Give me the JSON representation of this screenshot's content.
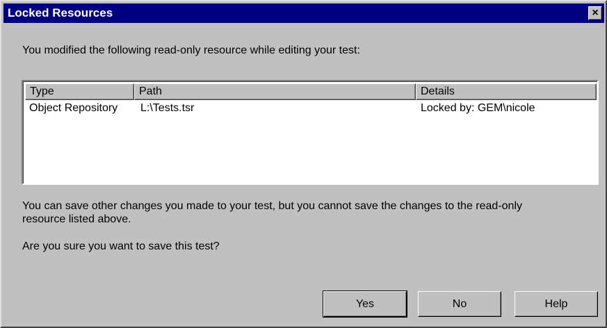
{
  "window": {
    "title": "Locked Resources",
    "close_label": "×"
  },
  "messages": {
    "intro": "You modified the following read-only resource while editing your test:",
    "note_line1": "You can save other changes you made to your test, but you cannot save the changes to the read-only",
    "note_line2": "resource listed above.",
    "question": "Are you sure you want to save this test?"
  },
  "table": {
    "columns": [
      "Type",
      "Path",
      "Details"
    ],
    "rows": [
      {
        "type": "Object Repository",
        "path": "L:\\Tests.tsr",
        "details": "Locked by: GEM\\nicole"
      }
    ]
  },
  "buttons": {
    "yes": "Yes",
    "no": "No",
    "help": "Help"
  },
  "colors": {
    "titlebar": "#000080",
    "face": "#c0c0c0"
  }
}
